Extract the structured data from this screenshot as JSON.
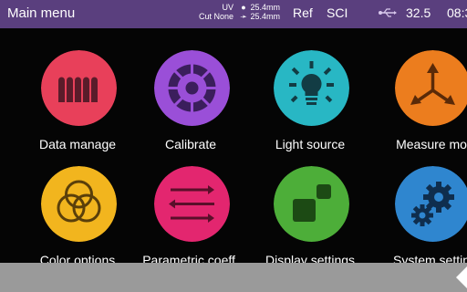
{
  "status_bar": {
    "title": "Main menu",
    "mode_line1": "UV",
    "mode_line2": "Cut None",
    "size_line1": "25.4mm",
    "size_line2": "25.4mm",
    "ref": "Ref",
    "sci": "SCI",
    "usb_icon": "usb-icon",
    "temperature": "32.5",
    "time": "08:3"
  },
  "menu": [
    {
      "label": "Data manage",
      "icon": "data-manage-icon",
      "color": "#e8405a"
    },
    {
      "label": "Calibrate",
      "icon": "calibrate-icon",
      "color": "#9a4fd8"
    },
    {
      "label": "Light source",
      "icon": "lightbulb-icon",
      "color": "#28b7c4"
    },
    {
      "label": "Measure mo",
      "icon": "measure-mode-icon",
      "color": "#ec7d1e"
    },
    {
      "label": "Color options",
      "icon": "color-options-icon",
      "color": "#f2b51e"
    },
    {
      "label": "Parametric coeff.",
      "icon": "parametric-coeff-icon",
      "color": "#e3266f"
    },
    {
      "label": "Display settings",
      "icon": "display-settings-icon",
      "color": "#4dae39"
    },
    {
      "label": "System settin",
      "icon": "system-settings-icon",
      "color": "#2f86cf"
    }
  ],
  "bottom_bar": {
    "back_icon": "back-arrow-icon"
  }
}
